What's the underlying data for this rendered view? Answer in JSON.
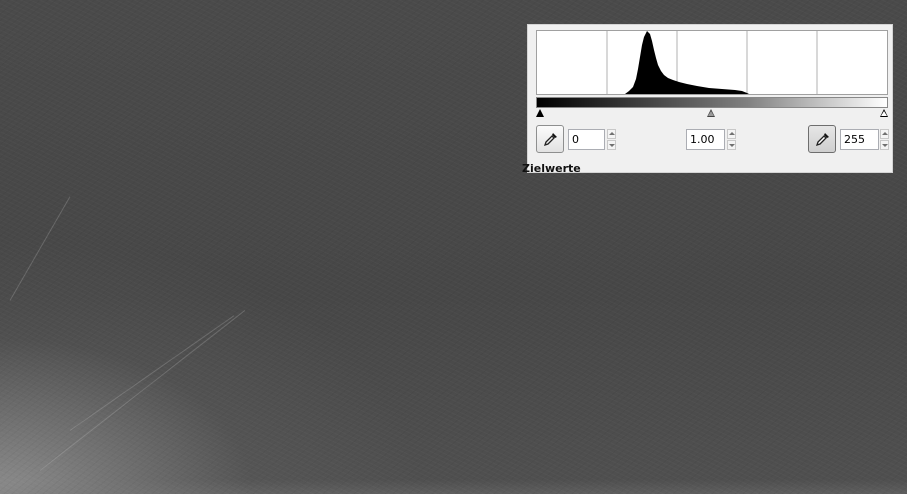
{
  "image_canvas": {
    "background": "#484848"
  },
  "levels_panel": {
    "background": "#f0f0f0",
    "histogram": {
      "icon": "histogram-chart",
      "fill_color": "#000000",
      "grid_divisions": 5
    },
    "input_slider": {
      "black_point": 0,
      "gamma": 1.0,
      "white_point": 255
    },
    "black_input": {
      "value": "0",
      "picker_icon": "eyedropper-icon"
    },
    "gamma_input": {
      "value": "1.00"
    },
    "white_input": {
      "value": "255",
      "picker_icon": "eyedropper-icon"
    },
    "section_label": "Zielwerte"
  }
}
